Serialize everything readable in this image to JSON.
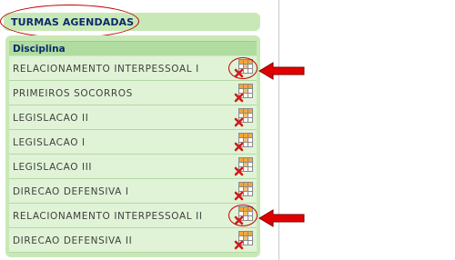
{
  "page": {
    "title": "TURMAS AGENDADAS",
    "column_header": "Disciplina"
  },
  "rows": [
    {
      "label": "RELACIONAMENTO INTERPESSOAL I",
      "icon": "schedule-delete-icon",
      "highlighted": true
    },
    {
      "label": "PRIMEIROS SOCORROS",
      "icon": "schedule-delete-icon",
      "highlighted": false
    },
    {
      "label": "LEGISLACAO II",
      "icon": "schedule-delete-icon",
      "highlighted": false
    },
    {
      "label": "LEGISLACAO I",
      "icon": "schedule-delete-icon",
      "highlighted": false
    },
    {
      "label": "LEGISLACAO III",
      "icon": "schedule-delete-icon",
      "highlighted": false
    },
    {
      "label": "DIRECAO DEFENSIVA I",
      "icon": "schedule-delete-icon",
      "highlighted": false
    },
    {
      "label": "RELACIONAMENTO INTERPESSOAL II",
      "icon": "schedule-delete-icon",
      "highlighted": true
    },
    {
      "label": "DIRECAO DEFENSIVA II",
      "icon": "schedule-delete-icon",
      "highlighted": false
    }
  ],
  "colors": {
    "panel": "#c8e9b7",
    "header": "#b0dca0",
    "row": "#e0f3d6",
    "title_text": "#0b2a6b",
    "annotation": "#c00000",
    "arrow": "#e10000"
  }
}
